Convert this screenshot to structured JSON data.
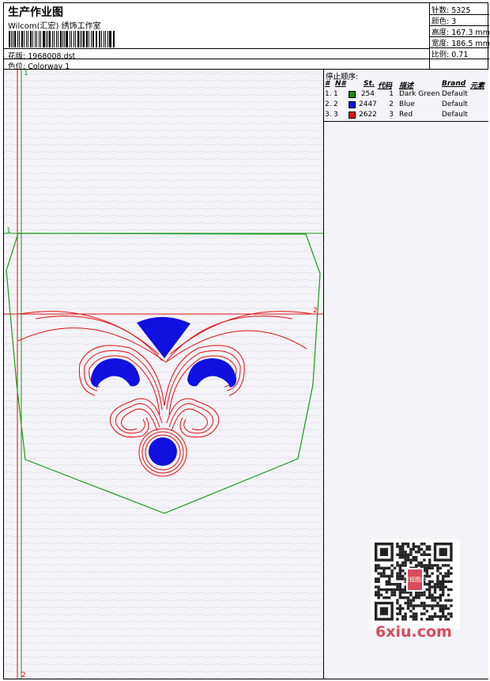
{
  "header": {
    "title": "生产作业图",
    "studio": "Wilcom(汇宏) 绣饰工作室",
    "design_label": "花版:",
    "design_value": "1968008.dst",
    "colorway_label": "色位:",
    "colorway_value": "Colorway 1"
  },
  "specs": {
    "stitches": "针数: 5325",
    "colors": "颜色: 3",
    "height": "高度: 167.3 mm",
    "width": "宽度: 186.5 mm",
    "scale": "比例: 0.71"
  },
  "stop_sequence": {
    "caption": "停止顺序:",
    "headers": {
      "num": "#",
      "no": "N#",
      "st": "St.",
      "code": "代码",
      "desc": "描述",
      "brand": "Brand",
      "element": "元素"
    },
    "rows": [
      {
        "num": "1.",
        "no": "1",
        "color": "#1a8a1a",
        "st": "254",
        "code": "1",
        "desc": "Dark Green",
        "brand": "Default"
      },
      {
        "num": "2.",
        "no": "2",
        "color": "#1010e0",
        "st": "2447",
        "code": "2",
        "desc": "Blue",
        "brand": "Default"
      },
      {
        "num": "3.",
        "no": "3",
        "color": "#e01010",
        "st": "2622",
        "code": "3",
        "desc": "Red",
        "brand": "Default"
      }
    ]
  },
  "canvas": {
    "marker_top": "1",
    "marker_left": "1",
    "marker_right": "2",
    "marker_bottom": "2",
    "colors": {
      "green": "#1a9a1a",
      "blue": "#1010e0",
      "red": "#e01010"
    }
  },
  "watermark": "6xiu.com",
  "qr_badge": "汉程图示"
}
